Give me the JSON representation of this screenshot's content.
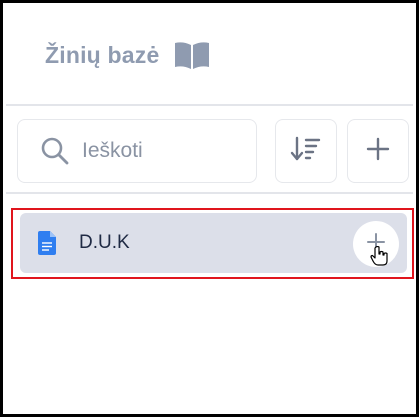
{
  "header": {
    "title": "Žinių bazė",
    "icon": "open-book-icon"
  },
  "toolbar": {
    "search": {
      "placeholder": "Ieškoti",
      "icon": "search-icon"
    },
    "sort_icon": "sort-descending-icon",
    "add_icon": "plus-icon"
  },
  "list": {
    "items": [
      {
        "label": "D.U.K",
        "icon": "document-icon",
        "add_icon": "plus-icon"
      }
    ]
  },
  "colors": {
    "title": "#8f9bb0",
    "item_background": "#dcdfe9",
    "item_text": "#1f2a44",
    "doc_icon": "#2f7ef0",
    "highlight_border": "#e0151d",
    "divider": "#e3e5ea"
  }
}
